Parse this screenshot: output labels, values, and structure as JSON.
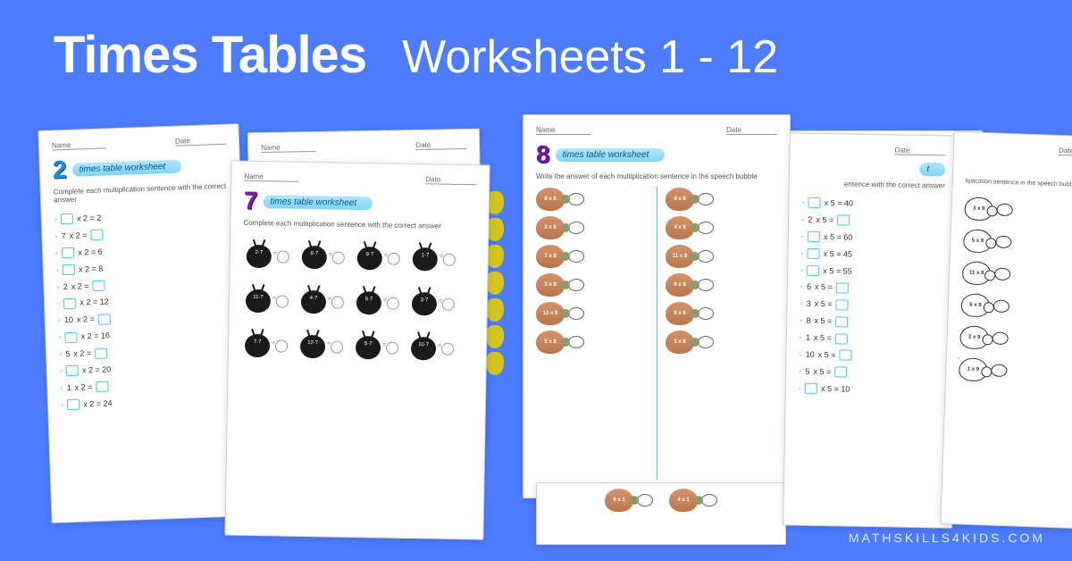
{
  "header": {
    "bold": "Times Tables",
    "light": "Worksheets 1 - 12"
  },
  "labels": {
    "name": "Name",
    "date": "Date",
    "ttw": "times table worksheet"
  },
  "subtitles": {
    "complete": "Complete each multiplication sentence with the correct answer",
    "bubble": "Write the answer of each multiplication sentence in the speech bubble"
  },
  "sheet2": {
    "num": "2",
    "rows": [
      {
        "pre": "",
        "a": "",
        "b": "x 2 = 2"
      },
      {
        "pre": "",
        "a": "7",
        "b": "x 2 ="
      },
      {
        "pre": "",
        "a": "",
        "b": "x 2 = 6"
      },
      {
        "pre": "",
        "a": "",
        "b": "x 2 = 8"
      },
      {
        "pre": "",
        "a": "2",
        "b": "x 2 ="
      },
      {
        "pre": "",
        "a": "",
        "b": "x 2 = 12"
      },
      {
        "pre": "",
        "a": "10",
        "b": "x 2 ="
      },
      {
        "pre": "",
        "a": "",
        "b": "x 2 = 16"
      },
      {
        "pre": "",
        "a": "5",
        "b": "x 2 ="
      },
      {
        "pre": "",
        "a": "",
        "b": "x 2 = 20"
      },
      {
        "pre": "",
        "a": "1",
        "b": "x 2 ="
      },
      {
        "pre": "",
        "a": "",
        "b": "x 2 = 24"
      }
    ]
  },
  "sheet7": {
    "num": "7",
    "bugs": [
      "2 × 7",
      "8 × 7",
      "9 × 7",
      "1 × 7",
      "11 × 7",
      "4 × 7",
      "6 × 7",
      "3 × 7",
      "7 × 7",
      "12 × 7",
      "5 × 7",
      "10 × 7"
    ]
  },
  "sheet8": {
    "num": "8",
    "left": [
      "9 x 8",
      "2 x 8",
      "7 x 8",
      "3 x 8",
      "12 x 8",
      "5 x 8"
    ],
    "right": [
      "8 x 8",
      "4 x 8",
      "11 x 8",
      "6 x 8",
      "9 x 8",
      "1 x 8"
    ]
  },
  "sheet5": {
    "rows": [
      {
        "a": "",
        "b": "x 5 = 40"
      },
      {
        "a": "2",
        "b": "x 5 ="
      },
      {
        "a": "",
        "b": "x 5 = 60"
      },
      {
        "a": "",
        "b": "x 5 = 45"
      },
      {
        "a": "",
        "b": "x 5 = 55"
      },
      {
        "a": "6",
        "b": "x 5 ="
      },
      {
        "a": "3",
        "b": "x 5 ="
      },
      {
        "a": "8",
        "b": "x 5 ="
      },
      {
        "a": "1",
        "b": "x 5 ="
      },
      {
        "a": "10",
        "b": "x 5 ="
      },
      {
        "a": "5",
        "b": "x 5 ="
      },
      {
        "a": "",
        "b": "x 5 = 10"
      }
    ]
  },
  "sheet9bw": [
    "3 x 9",
    "5 x 9",
    "11 x 9",
    "6 x 9",
    "2 x 9",
    "1 x 9"
  ],
  "watermark": "MATHSKILLS4KIDS.COM"
}
